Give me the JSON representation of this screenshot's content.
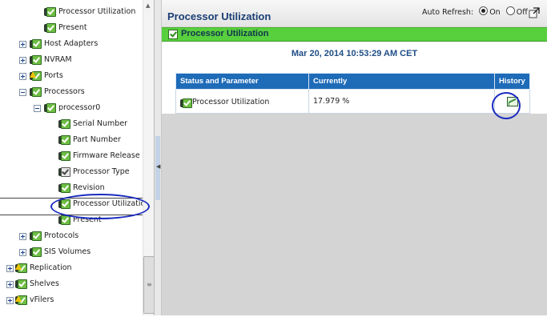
{
  "tree": {
    "items": [
      {
        "label": "Processor Utilization",
        "level": 2,
        "expander": null,
        "icon": "status-ok"
      },
      {
        "label": "Present",
        "level": 2,
        "expander": null,
        "icon": "status-ok"
      },
      {
        "label": "Host Adapters",
        "level": 1,
        "expander": "plus",
        "icon": "status-ok"
      },
      {
        "label": "NVRAM",
        "level": 1,
        "expander": "plus",
        "icon": "status-ok"
      },
      {
        "label": "Ports",
        "level": 1,
        "expander": "plus",
        "icon": "status-warning"
      },
      {
        "label": "Processors",
        "level": 1,
        "expander": "minus",
        "icon": "status-ok"
      },
      {
        "label": "processor0",
        "level": 2,
        "expander": "minus",
        "icon": "status-ok"
      },
      {
        "label": "Serial Number",
        "level": 3,
        "expander": null,
        "icon": "status-ok"
      },
      {
        "label": "Part Number",
        "level": 3,
        "expander": null,
        "icon": "status-ok"
      },
      {
        "label": "Firmware Release",
        "level": 3,
        "expander": null,
        "icon": "status-ok"
      },
      {
        "label": "Processor Type",
        "level": 3,
        "expander": null,
        "icon": "status-unknown"
      },
      {
        "label": "Revision",
        "level": 3,
        "expander": null,
        "icon": "status-ok"
      },
      {
        "label": "Processor Utilization",
        "level": 3,
        "expander": null,
        "icon": "status-ok",
        "selected": true
      },
      {
        "label": "Present",
        "level": 3,
        "expander": null,
        "icon": "status-ok"
      },
      {
        "label": "Protocols",
        "level": 1,
        "expander": "plus",
        "icon": "status-ok"
      },
      {
        "label": "SIS Volumes",
        "level": 1,
        "expander": "plus",
        "icon": "status-ok"
      },
      {
        "label": "Replication",
        "level": 0,
        "expander": "plus",
        "icon": "status-warning"
      },
      {
        "label": "Shelves",
        "level": 0,
        "expander": "plus",
        "icon": "status-ok"
      },
      {
        "label": "vFilers",
        "level": 0,
        "expander": "plus",
        "icon": "status-warning"
      }
    ]
  },
  "header": {
    "title": "Processor Utilization",
    "auto_refresh_label": "Auto Refresh:",
    "on_label": "On",
    "off_label": "Off",
    "auto_refresh_value": "On"
  },
  "status_bar": {
    "label": "Processor Utilization",
    "icon": "status-ok-icon"
  },
  "timestamp": "Mar 20, 2014 10:53:29 AM CET",
  "table": {
    "headers": [
      "Status and Parameter",
      "Currently",
      "History"
    ],
    "rows": [
      {
        "parameter": "Processor Utilization",
        "currently": "17.979 %",
        "history_icon": "chart-icon"
      }
    ]
  },
  "colors": {
    "title_blue": "#1a3e74",
    "table_header_blue": "#1e6bb8",
    "status_green": "#58cf3d",
    "annotation_oval": "#1a2bbf"
  }
}
